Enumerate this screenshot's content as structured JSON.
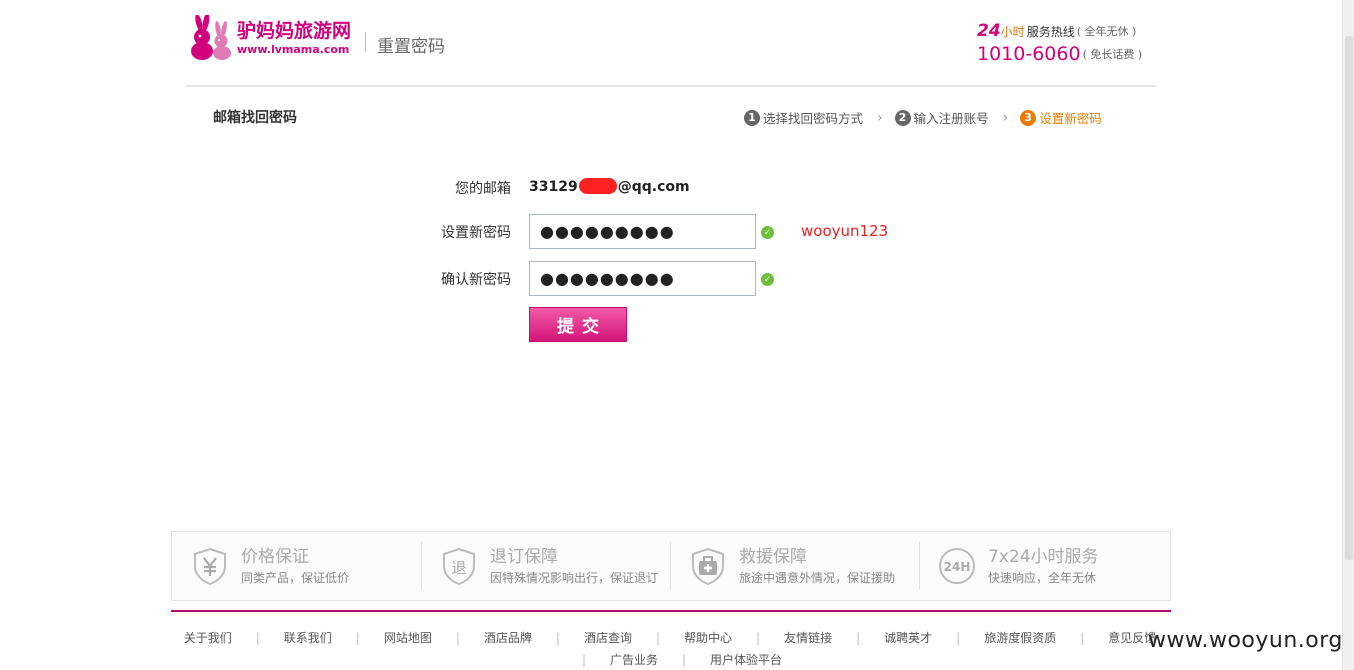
{
  "header": {
    "logo_text": "驴妈妈旅游网",
    "logo_url": "www.lvmama.com",
    "page_title": "重置密码",
    "hotline": {
      "hours": "24",
      "hours_unit": "小时",
      "label": "服务热线",
      "note": "( 全年无休 )",
      "number": "1010-6060",
      "fee_note": "( 免长话费 )"
    }
  },
  "section": {
    "title": "邮箱找回密码",
    "steps": [
      {
        "num": "1",
        "label": "选择找回密码方式"
      },
      {
        "num": "2",
        "label": "输入注册账号"
      },
      {
        "num": "3",
        "label": "设置新密码"
      }
    ]
  },
  "form": {
    "email_label": "您的邮箱",
    "email_prefix": "33129",
    "email_suffix": "@qq.com",
    "new_password_label": "设置新密码",
    "new_password_value": "●●●●●●●●●",
    "confirm_password_label": "确认新密码",
    "confirm_password_value": "●●●●●●●●●",
    "annotation": "wooyun123",
    "submit_label": "提交"
  },
  "guarantees": [
    {
      "icon": "yen-shield-icon",
      "title": "价格保证",
      "desc": "同类产品，保证低价"
    },
    {
      "icon": "refund-shield-icon",
      "title": "退订保障",
      "desc": "因特殊情况影响出行，保证退订"
    },
    {
      "icon": "firstaid-kit-icon",
      "title": "救援保障",
      "desc": "旅途中遇意外情况，保证援助"
    },
    {
      "icon": "24h-clock-icon",
      "title": "7x24小时服务",
      "desc": "快速响应，全年无休"
    }
  ],
  "footer_links": [
    "关于我们",
    "联系我们",
    "网站地图",
    "酒店品牌",
    "酒店查询",
    "帮助中心",
    "友情链接",
    "诚聘英才",
    "旅游度假资质",
    "意见反馈",
    "广告业务",
    "用户体验平台"
  ],
  "watermark": "www.wooyun.org",
  "colors": {
    "brand": "#d3007d",
    "step_active": "#e77c00",
    "annotation": "#e82020",
    "valid": "#6bbf3a"
  }
}
